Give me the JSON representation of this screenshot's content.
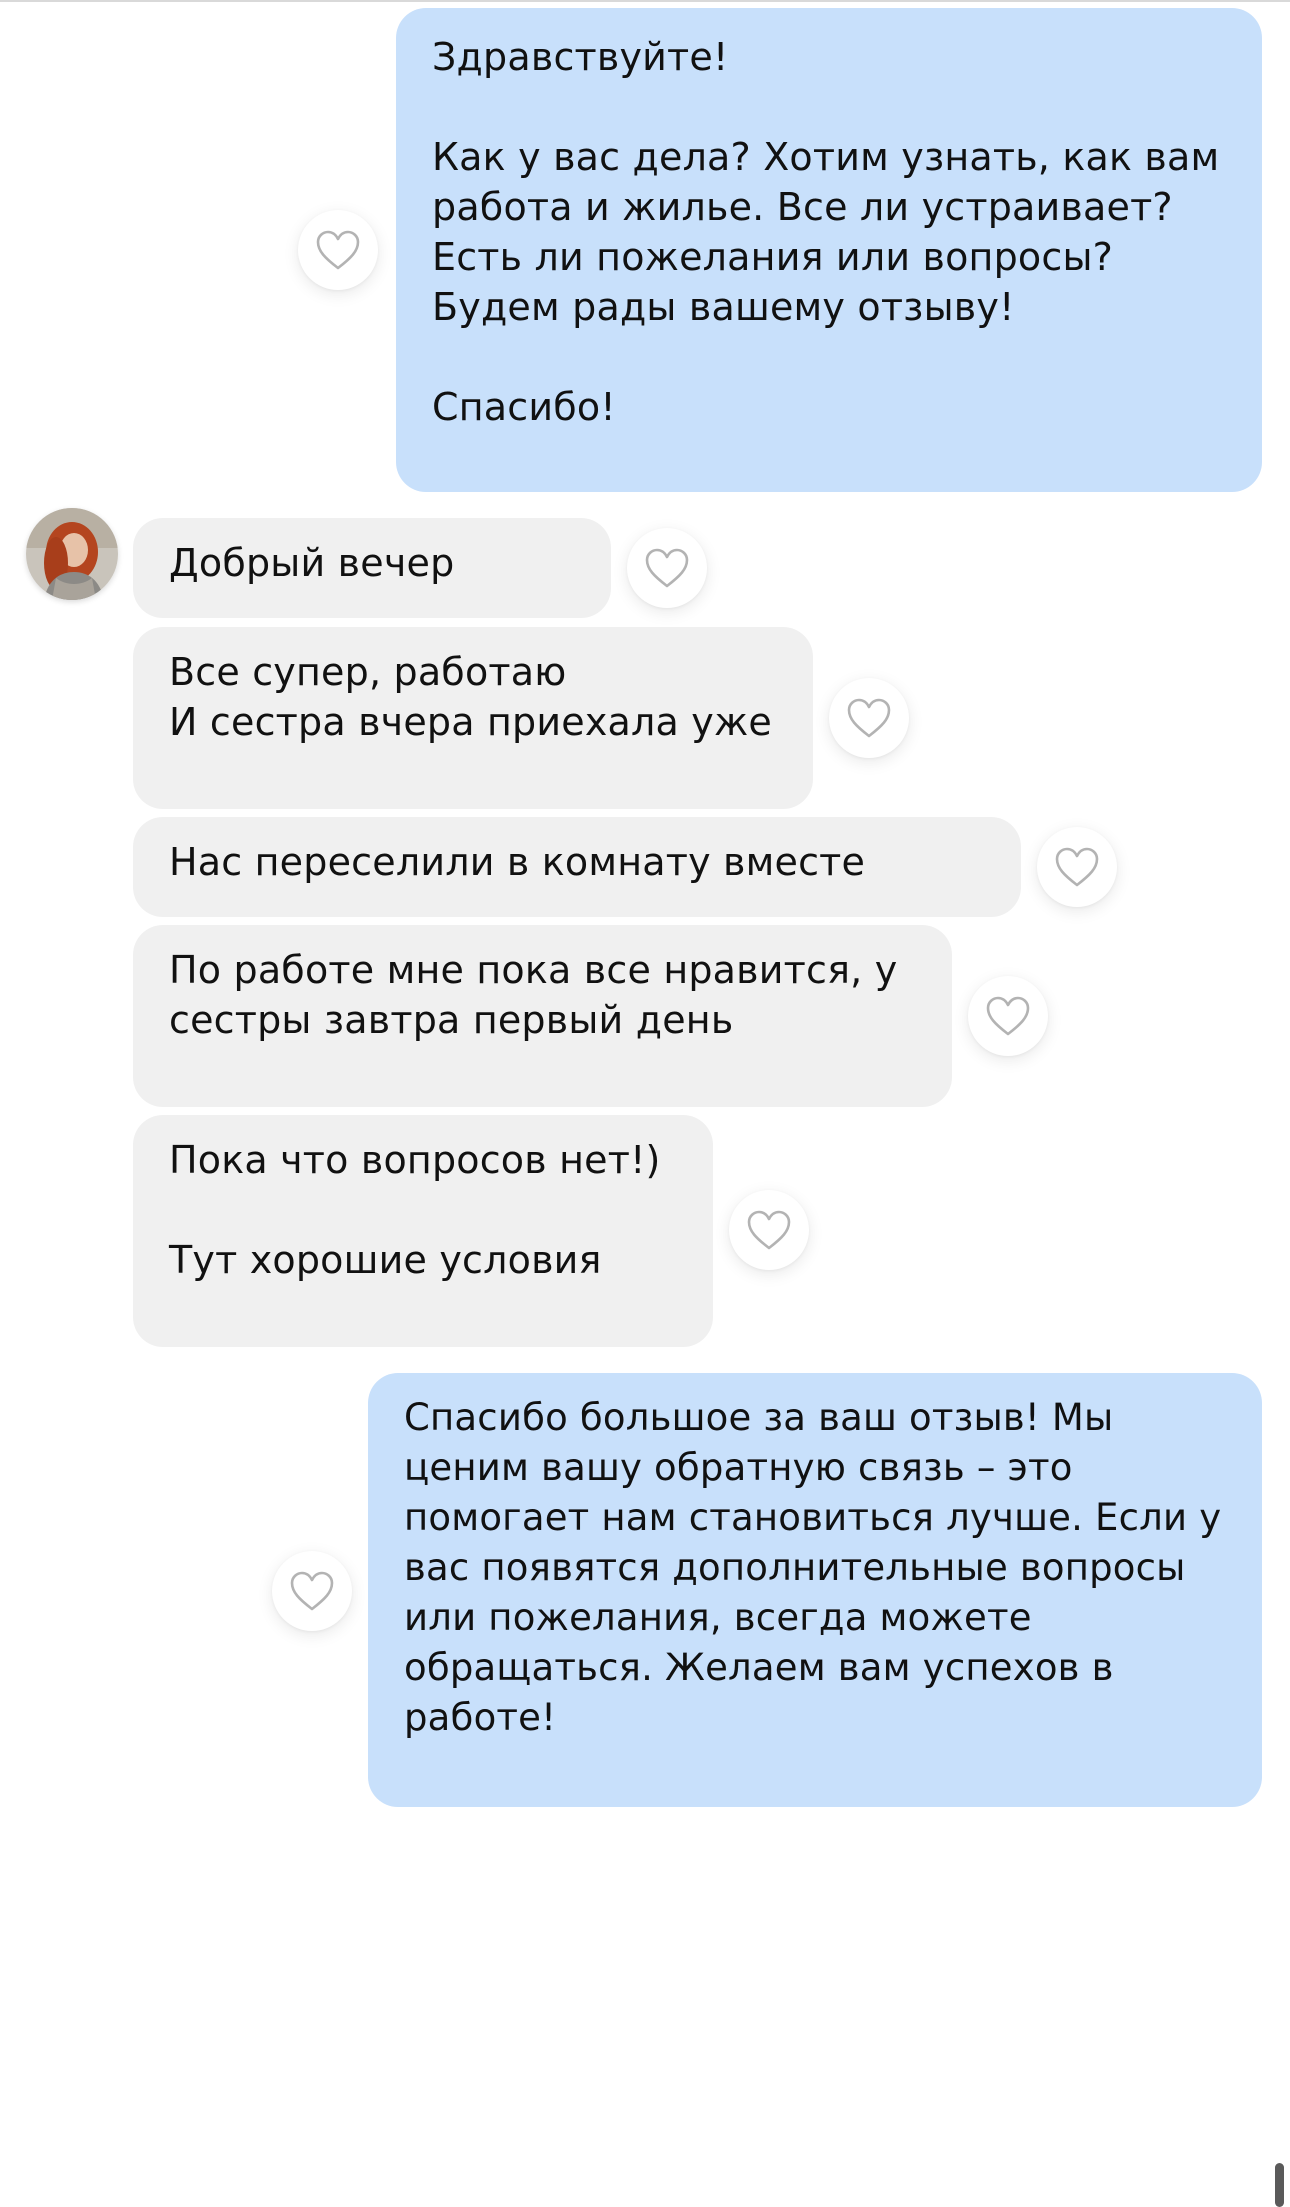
{
  "chat": {
    "messages": [
      {
        "direction": "outgoing",
        "text": "Здравствуйте!\n\nКак у вас дела? Хотим узнать, как вам работа и жилье. Все ли устраивает? Есть ли пожелания или вопросы? Будем рады вашему отзыву!\n\nСпасибо!"
      },
      {
        "direction": "incoming",
        "text": "Добрый вечер"
      },
      {
        "direction": "incoming",
        "text": "Все супер, работаю\nИ сестра вчера приехала уже"
      },
      {
        "direction": "incoming",
        "text": "Нас переселили в комнату вместе"
      },
      {
        "direction": "incoming",
        "text": "По работе мне пока все нравится, у сестры завтра первый день"
      },
      {
        "direction": "incoming",
        "text": "Пока что вопросов нет!)\n\nТут хорошие условия"
      },
      {
        "direction": "outgoing",
        "text": "Спасибо большое за ваш отзыв! Мы ценим вашу обратную связь – это помогает нам становиться лучше. Если у вас появятся дополнительные вопросы или пожелания, всегда можете обращаться. Желаем вам успехов в работе!"
      }
    ]
  },
  "icons": {
    "like": "heart-outline-icon",
    "avatar": "user-avatar"
  },
  "colors": {
    "outgoing_bubble": "#c8e0fb",
    "incoming_bubble": "#f0f0f0",
    "heart_stroke": "#b3b3b3",
    "background": "#ffffff"
  }
}
